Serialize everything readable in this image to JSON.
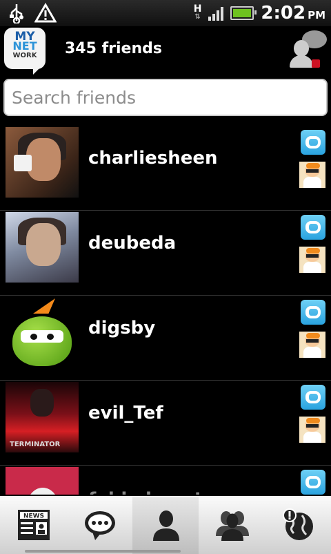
{
  "status_bar": {
    "icons": [
      "usb-icon",
      "warning-icon",
      "network-type-icon",
      "signal-icon",
      "battery-charging-icon"
    ],
    "network_type": "H",
    "time": "2:02",
    "ampm": "PM"
  },
  "header": {
    "logo_text": [
      "MY",
      "NET",
      "WORK"
    ],
    "friend_count": "345 friends",
    "profile_chat_icon": "profile-chat-icon"
  },
  "search": {
    "placeholder": "Search friends",
    "value": ""
  },
  "friends": [
    {
      "name": "charliesheen",
      "networks": [
        "twitter",
        "digsby"
      ]
    },
    {
      "name": "deubeda",
      "networks": [
        "twitter",
        "digsby"
      ]
    },
    {
      "name": "digsby",
      "networks": [
        "twitter",
        "digsby"
      ]
    },
    {
      "name": "evil_Tef",
      "networks": [
        "twitter",
        "digsby"
      ]
    },
    {
      "name": "fabbyheyetna",
      "networks": [
        "twitter"
      ]
    }
  ],
  "poster_text": "TERMINATOR",
  "bottom_tabs": [
    {
      "icon": "news-icon",
      "label": "NEWS"
    },
    {
      "icon": "chat-bubble-icon"
    },
    {
      "icon": "person-icon",
      "active": true
    },
    {
      "icon": "group-icon"
    },
    {
      "icon": "globe-alert-icon"
    }
  ],
  "colors": {
    "background": "#000000",
    "twitter": "#2aa3df",
    "signal": "#6ec11f"
  }
}
